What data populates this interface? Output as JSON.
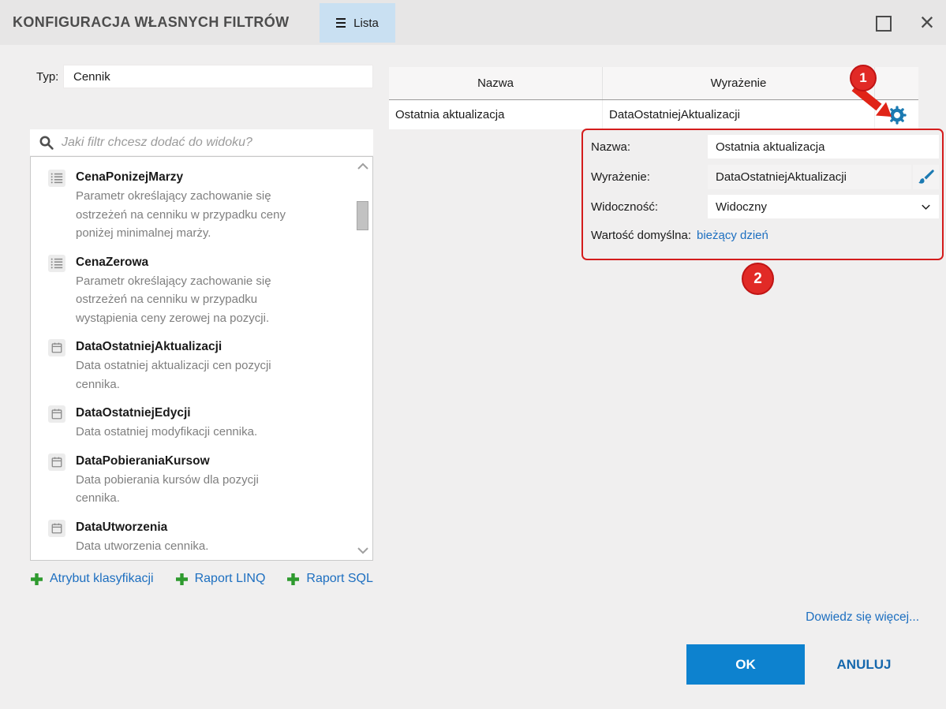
{
  "window": {
    "title": "KONFIGURACJA WŁASNYCH FILTRÓW",
    "tab": "Lista"
  },
  "left": {
    "type_label": "Typ:",
    "type_value": "Cennik",
    "search_placeholder": "Jaki filtr chcesz dodać do widoku?",
    "filters": [
      {
        "icon": "list-icon",
        "name": "CenaPonizejMarzy",
        "desc": "Parametr określający zachowanie się\nostrzeżeń na cenniku w przypadku ceny\nponiżej minimalnej marży."
      },
      {
        "icon": "list-icon",
        "name": "CenaZerowa",
        "desc": "Parametr określający zachowanie się\nostrzeżeń na cenniku w przypadku\nwystąpienia ceny zerowej na pozycji."
      },
      {
        "icon": "calendar-icon",
        "name": "DataOstatniejAktualizacji",
        "desc": "Data ostatniej aktualizacji cen pozycji\ncennika."
      },
      {
        "icon": "calendar-icon",
        "name": "DataOstatniejEdycji",
        "desc": "Data ostatniej modyfikacji cennika."
      },
      {
        "icon": "calendar-icon",
        "name": "DataPobieraniaKursow",
        "desc": "Data pobierania kursów dla pozycji\ncennika."
      },
      {
        "icon": "calendar-icon",
        "name": "DataUtworzenia",
        "desc": "Data utworzenia cennika."
      }
    ],
    "add_links": [
      {
        "label": "Atrybut klasyfikacji"
      },
      {
        "label": "Raport LINQ"
      },
      {
        "label": "Raport SQL"
      }
    ]
  },
  "table": {
    "columns": [
      "Nazwa",
      "Wyrażenie"
    ],
    "rows": [
      {
        "nazwa": "Ostatnia aktualizacja",
        "wyrazenie": "DataOstatniejAktualizacji"
      }
    ]
  },
  "detail": {
    "nazwa_label": "Nazwa:",
    "nazwa_value": "Ostatnia aktualizacja",
    "wyrazenie_label": "Wyrażenie:",
    "wyrazenie_value": "DataOstatniejAktualizacji",
    "widocznosc_label": "Widoczność:",
    "widocznosc_value": "Widoczny",
    "wartosc_label": "Wartość domyślna:",
    "wartosc_value": "bieżący dzień"
  },
  "annotations": {
    "step1": "1",
    "step2": "2"
  },
  "footer": {
    "learn_more": "Dowiedz się więcej...",
    "ok": "OK",
    "cancel": "ANULUJ"
  },
  "icons": [
    "menu-bars-icon",
    "maximize-icon",
    "close-icon",
    "search-icon",
    "list-icon",
    "calendar-icon",
    "gear-icon",
    "brush-icon",
    "chevron-down-icon",
    "chevron-up-icon",
    "plus-icon",
    "arrow-annotation"
  ],
  "colors": {
    "accent_blue": "#0d82cf",
    "icon_blue": "#1b7ab2",
    "link_blue": "#1d6fc0",
    "callout_red": "#d41c1c",
    "plus_green": "#2e9a2e",
    "tab_blue": "#c9e0f2"
  }
}
